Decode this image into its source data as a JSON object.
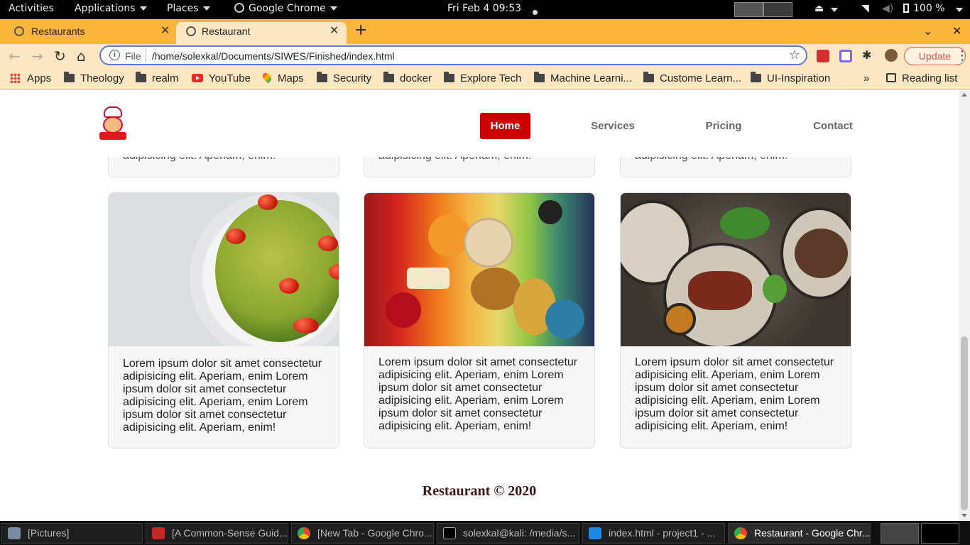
{
  "system_bar": {
    "activities": "Activities",
    "applications": "Applications",
    "places": "Places",
    "app_name": "Google Chrome",
    "clock": "Fri Feb 4  09:53",
    "battery": "100 %"
  },
  "browser": {
    "tabs": [
      {
        "title": "Restaurants",
        "active": false
      },
      {
        "title": "Restaurant",
        "active": true
      }
    ],
    "address": {
      "scheme_label": "File",
      "url": "/home/solexkal/Documents/SIWES/Finished/index.html"
    },
    "update_label": "Update",
    "bookmarks": [
      {
        "label": "Apps",
        "icon": "apps-grid-icon"
      },
      {
        "label": "Theology",
        "icon": "folder-icon"
      },
      {
        "label": "realm",
        "icon": "folder-icon"
      },
      {
        "label": "YouTube",
        "icon": "youtube-icon"
      },
      {
        "label": "Maps",
        "icon": "maps-icon"
      },
      {
        "label": "Security",
        "icon": "folder-icon"
      },
      {
        "label": "docker",
        "icon": "folder-icon"
      },
      {
        "label": "Explore Tech",
        "icon": "folder-icon"
      },
      {
        "label": "Machine Learni...",
        "icon": "folder-icon"
      },
      {
        "label": "Custome Learn...",
        "icon": "folder-icon"
      },
      {
        "label": "UI-Inspiration",
        "icon": "folder-icon"
      }
    ],
    "overflow_label": "»",
    "reading_list": "Reading list"
  },
  "page": {
    "nav": {
      "home": "Home",
      "services": "Services",
      "pricing": "Pricing",
      "contact": "Contact"
    },
    "top_cards_partial_text": "adipisicing elit. Aperiam, enim!",
    "cards": [
      {
        "image": "pasta-salad",
        "text": "Lorem ipsum dolor sit amet consectetur adipisicing elit. Aperiam, enim Lorem ipsum dolor sit amet consectetur adipisicing elit. Aperiam, enim Lorem ipsum dolor sit amet consectetur adipisicing elit. Aperiam, enim!"
      },
      {
        "image": "assorted-food-spread",
        "text": "Lorem ipsum dolor sit amet consectetur adipisicing elit. Aperiam, enim Lorem ipsum dolor sit amet consectetur adipisicing elit. Aperiam, enim Lorem ipsum dolor sit amet consectetur adipisicing elit. Aperiam, enim!"
      },
      {
        "image": "steak-bowls",
        "text": "Lorem ipsum dolor sit amet consectetur adipisicing elit. Aperiam, enim Lorem ipsum dolor sit amet consectetur adipisicing elit. Aperiam, enim Lorem ipsum dolor sit amet consectetur adipisicing elit. Aperiam, enim!"
      }
    ],
    "footer": "Restaurant © 2020",
    "accent_color": "#cc0000"
  },
  "taskbar": {
    "items": [
      {
        "label": "[Pictures]",
        "icon": "files-icon"
      },
      {
        "label": "[A Common-Sense Guid...",
        "icon": "pdf-icon"
      },
      {
        "label": "[New Tab - Google Chro...",
        "icon": "chrome-icon"
      },
      {
        "label": "solexkal@kali: /media/s...",
        "icon": "terminal-icon"
      },
      {
        "label": "index.html - project1 - ...",
        "icon": "vscode-icon"
      },
      {
        "label": "Restaurant - Google Chr...",
        "icon": "chrome-icon"
      }
    ]
  }
}
